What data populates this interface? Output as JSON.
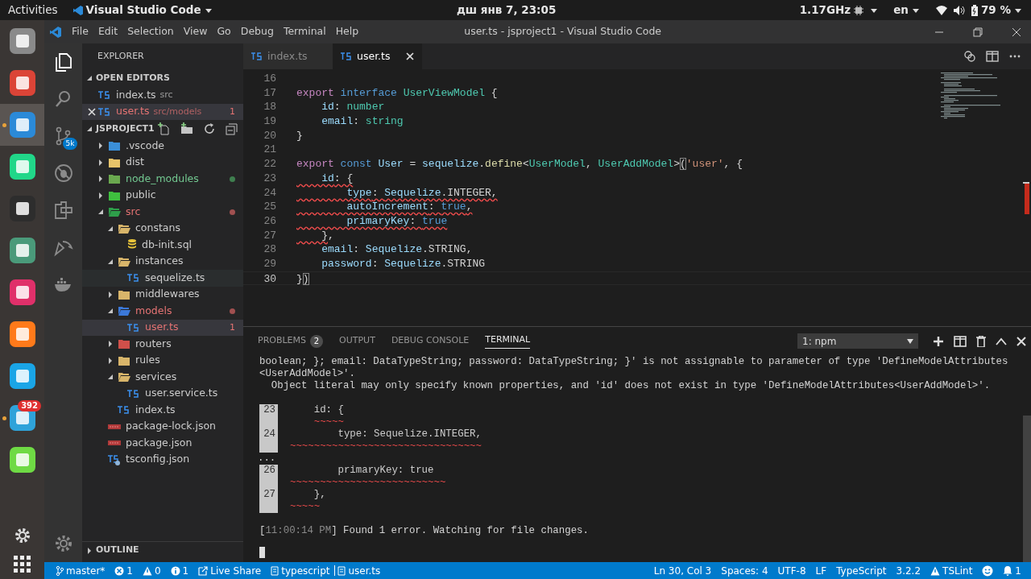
{
  "topbar": {
    "activities": "Activities",
    "app": "Visual Studio Code",
    "clock": "дш янв  7, 23:05",
    "cpu": "1.17GHz",
    "lang": "en",
    "battery": "79 %"
  },
  "dock": {
    "apps": [
      {
        "color": "#8a8a8a",
        "running": false,
        "selected": false
      },
      {
        "color": "#db4437",
        "running": false,
        "selected": false
      },
      {
        "color": "#2b8ad8",
        "running": true,
        "selected": true
      },
      {
        "color": "#21d789",
        "running": false,
        "selected": false
      },
      {
        "color": "#2d2d2d",
        "running": false,
        "selected": false
      },
      {
        "color": "#4a9a7a",
        "running": false,
        "selected": false
      },
      {
        "color": "#e0306a",
        "running": false,
        "selected": false
      },
      {
        "color": "#ff7a1a",
        "running": false,
        "selected": false
      },
      {
        "color": "#1aa5e6",
        "running": false,
        "selected": false
      },
      {
        "color": "#2fa3da",
        "running": true,
        "selected": false,
        "badge": "392"
      },
      {
        "color": "#6fda44",
        "running": false,
        "selected": false
      }
    ]
  },
  "window": {
    "title": "user.ts - jsproject1 - Visual Studio Code",
    "menu": [
      "File",
      "Edit",
      "Selection",
      "View",
      "Go",
      "Debug",
      "Terminal",
      "Help"
    ]
  },
  "activity_bar": [
    {
      "kind": "files",
      "selected": true
    },
    {
      "kind": "search",
      "selected": false
    },
    {
      "kind": "scm",
      "selected": false,
      "badge": "5k"
    },
    {
      "kind": "debug",
      "selected": false
    },
    {
      "kind": "extensions",
      "selected": false
    },
    {
      "kind": "share",
      "selected": false
    },
    {
      "kind": "docker",
      "selected": false
    }
  ],
  "sidebar": {
    "title": "EXPLORER",
    "open_editors": {
      "title": "OPEN EDITORS",
      "items": [
        {
          "label": "index.ts",
          "description": "src",
          "selected": false,
          "error": false
        },
        {
          "label": "user.ts",
          "description": "src/models",
          "selected": true,
          "error": true,
          "badge": "1"
        }
      ]
    },
    "project": {
      "title": "JSPROJECT1",
      "items": [
        {
          "label": ".vscode",
          "kind": "folder",
          "color": "#3b8fd8",
          "expanded": false
        },
        {
          "label": "dist",
          "kind": "folder",
          "color": "#e8c46a",
          "expanded": false
        },
        {
          "label": "node_modules",
          "kind": "folder",
          "color": "#6aa84f",
          "expanded": false,
          "untracked": true
        },
        {
          "label": "public",
          "kind": "folder",
          "color": "#3fbf3f",
          "expanded": false
        },
        {
          "label": "src",
          "kind": "folder",
          "color": "#2e9e4a",
          "expanded": true,
          "error": true,
          "children": [
            {
              "label": "constans",
              "kind": "folder",
              "color": "#d8b56a",
              "expanded": true,
              "children": [
                {
                  "label": "db-init.sql",
                  "kind": "sql"
                }
              ]
            },
            {
              "label": "instances",
              "kind": "folder",
              "color": "#d8b56a",
              "expanded": true,
              "children": [
                {
                  "label": "sequelize.ts",
                  "kind": "ts",
                  "hovered": true
                }
              ]
            },
            {
              "label": "middlewares",
              "kind": "folder",
              "color": "#d8b56a",
              "expanded": false
            },
            {
              "label": "models",
              "kind": "folder",
              "color": "#3b78d8",
              "expanded": true,
              "error": true,
              "children": [
                {
                  "label": "user.ts",
                  "kind": "ts",
                  "error": true,
                  "badge": "1",
                  "selected": true
                }
              ]
            },
            {
              "label": "routers",
              "kind": "folder",
              "color": "#d0504a",
              "expanded": false
            },
            {
              "label": "rules",
              "kind": "folder",
              "color": "#d8b56a",
              "expanded": false
            },
            {
              "label": "services",
              "kind": "folder",
              "color": "#d8b56a",
              "expanded": true,
              "children": [
                {
                  "label": "user.service.ts",
                  "kind": "ts"
                }
              ]
            },
            {
              "label": "index.ts",
              "kind": "ts"
            }
          ]
        },
        {
          "label": "package-lock.json",
          "kind": "json"
        },
        {
          "label": "package.json",
          "kind": "json"
        },
        {
          "label": "tsconfig.json",
          "kind": "tsconfig"
        }
      ]
    },
    "outline": {
      "title": "OUTLINE",
      "expanded": false
    }
  },
  "tabs": [
    {
      "label": "index.ts",
      "selected": false
    },
    {
      "label": "user.ts",
      "selected": true
    }
  ],
  "editor": {
    "lines": [
      {
        "number": "16",
        "current": false
      },
      {
        "number": "17",
        "current": false,
        "tokens": [
          {
            "text": "export",
            "kind": "kw"
          },
          {
            "text": " interface",
            "kind": "storage"
          },
          {
            "text": " UserViewModel",
            "kind": "type"
          },
          {
            "text": " {",
            "kind": "plain"
          }
        ]
      },
      {
        "number": "18",
        "current": false,
        "tokens": [
          {
            "text": "    id",
            "kind": "prop"
          },
          {
            "text": ": ",
            "kind": "plain"
          },
          {
            "text": "number",
            "kind": "type"
          }
        ]
      },
      {
        "number": "19",
        "current": false,
        "tokens": [
          {
            "text": "    email",
            "kind": "prop"
          },
          {
            "text": ": ",
            "kind": "plain"
          },
          {
            "text": "string",
            "kind": "type"
          }
        ]
      },
      {
        "number": "20",
        "current": false,
        "tokens": [
          {
            "text": "}",
            "kind": "plain"
          }
        ]
      },
      {
        "number": "21",
        "current": false
      },
      {
        "number": "22",
        "current": false,
        "tokens": [
          {
            "text": "export",
            "kind": "kw"
          },
          {
            "text": " const",
            "kind": "storage"
          },
          {
            "text": " User",
            "kind": "var"
          },
          {
            "text": " = ",
            "kind": "plain"
          },
          {
            "text": "sequelize",
            "kind": "var"
          },
          {
            "text": ".",
            "kind": "plain"
          },
          {
            "text": "define",
            "kind": "fn"
          },
          {
            "text": "<",
            "kind": "plain"
          },
          {
            "text": "UserModel",
            "kind": "type"
          },
          {
            "text": ", ",
            "kind": "plain"
          },
          {
            "text": "UserAddModel",
            "kind": "type"
          },
          {
            "text": ">",
            "kind": "plain"
          },
          {
            "text": "(",
            "kind": "bracket"
          },
          {
            "text": "'user'",
            "kind": "str"
          },
          {
            "text": ", {",
            "kind": "plain"
          }
        ]
      },
      {
        "number": "23",
        "current": false,
        "tokens": [
          {
            "text": "    id",
            "kind": "prop",
            "error": true
          },
          {
            "text": ": {",
            "kind": "plain",
            "error": true
          }
        ]
      },
      {
        "number": "24",
        "current": false,
        "tokens": [
          {
            "text": "        type",
            "kind": "prop",
            "error": true
          },
          {
            "text": ": ",
            "kind": "plain",
            "error": true
          },
          {
            "text": "Sequelize",
            "kind": "var",
            "error": true
          },
          {
            "text": ".INTEGER,",
            "kind": "plain",
            "error": true
          }
        ]
      },
      {
        "number": "25",
        "current": false,
        "tokens": [
          {
            "text": "        autoIncrement",
            "kind": "prop",
            "error": true
          },
          {
            "text": ": ",
            "kind": "plain",
            "error": true
          },
          {
            "text": "true",
            "kind": "storage",
            "error": true
          },
          {
            "text": ",",
            "kind": "plain",
            "error": true
          }
        ]
      },
      {
        "number": "26",
        "current": false,
        "tokens": [
          {
            "text": "        primaryKey",
            "kind": "prop",
            "error": true
          },
          {
            "text": ": ",
            "kind": "plain",
            "error": true
          },
          {
            "text": "true",
            "kind": "storage",
            "error": true
          }
        ]
      },
      {
        "number": "27",
        "current": false,
        "tokens": [
          {
            "text": "    }",
            "kind": "plain",
            "error": true
          },
          {
            "text": ",",
            "kind": "plain",
            "error": false
          }
        ]
      },
      {
        "number": "28",
        "current": false,
        "tokens": [
          {
            "text": "    email",
            "kind": "prop"
          },
          {
            "text": ": ",
            "kind": "plain"
          },
          {
            "text": "Sequelize",
            "kind": "var"
          },
          {
            "text": ".STRING,",
            "kind": "plain"
          }
        ]
      },
      {
        "number": "29",
        "current": false,
        "tokens": [
          {
            "text": "    password",
            "kind": "prop"
          },
          {
            "text": ": ",
            "kind": "plain"
          },
          {
            "text": "Sequelize",
            "kind": "var"
          },
          {
            "text": ".STRING",
            "kind": "plain"
          }
        ]
      },
      {
        "number": "30",
        "current": true,
        "tokens": [
          {
            "text": "}",
            "kind": "plain"
          },
          {
            "text": ")",
            "kind": "bracket"
          }
        ]
      }
    ]
  },
  "panel": {
    "tabs": [
      {
        "label": "PROBLEMS",
        "selected": false,
        "badge": "2"
      },
      {
        "label": "OUTPUT",
        "selected": false
      },
      {
        "label": "DEBUG CONSOLE",
        "selected": false
      },
      {
        "label": "TERMINAL",
        "selected": true
      }
    ],
    "terminal_select": "1: npm",
    "terminal": [
      {
        "kind": "message",
        "parts": [
          {
            "text": "boolean; }; email: DataTypeString; password: DataTypeString; }' is not assignable to parameter of type 'DefineModelAttributes",
            "kind": "plain"
          }
        ]
      },
      {
        "kind": "message",
        "parts": [
          {
            "text": "<UserAddModel>'.",
            "kind": "plain"
          }
        ]
      },
      {
        "kind": "message",
        "parts": [
          {
            "text": "  Object literal may only specify known properties, and 'id' does not exist in type 'DefineModelAttributes<UserAddModel>'.",
            "kind": "plain"
          }
        ]
      },
      {
        "kind": "blank"
      },
      {
        "kind": "code",
        "number": "23",
        "text": "    id: {"
      },
      {
        "kind": "marker",
        "text": "    ~~~~~"
      },
      {
        "kind": "code",
        "number": "24",
        "text": "        type: Sequelize.INTEGER,"
      },
      {
        "kind": "marker",
        "text": "~~~~~~~~~~~~~~~~~~~~~~~~~~~~~~~~"
      },
      {
        "kind": "ellipsis",
        "number": "..."
      },
      {
        "kind": "code",
        "number": "26",
        "text": "        primaryKey: true"
      },
      {
        "kind": "marker",
        "text": "~~~~~~~~~~~~~~~~~~~~~~~~~~"
      },
      {
        "kind": "code",
        "number": "27",
        "text": "    },"
      },
      {
        "kind": "marker",
        "text": "~~~~~"
      },
      {
        "kind": "blank"
      },
      {
        "kind": "message",
        "parts": [
          {
            "text": "[",
            "kind": "plain"
          },
          {
            "text": "11:00:14 PM",
            "kind": "time"
          },
          {
            "text": "] Found 1 error. Watching for file changes.",
            "kind": "plain"
          }
        ]
      },
      {
        "kind": "blank"
      },
      {
        "kind": "cursor"
      }
    ]
  },
  "status_bar": {
    "left": [
      {
        "kind": "branch",
        "text": "master*"
      },
      {
        "kind": "errors",
        "text": "1"
      },
      {
        "kind": "warnings",
        "text": "0"
      },
      {
        "kind": "info",
        "text": "1"
      },
      {
        "kind": "share",
        "text": "Live Share"
      },
      {
        "kind": "lang-ts",
        "text": "typescript"
      },
      {
        "kind": "file",
        "text": "user.ts"
      }
    ],
    "right": [
      {
        "kind": "text",
        "text": "Ln 30, Col 3"
      },
      {
        "kind": "text",
        "text": "Spaces: 4"
      },
      {
        "kind": "text",
        "text": "UTF-8"
      },
      {
        "kind": "text",
        "text": "LF"
      },
      {
        "kind": "text",
        "text": "TypeScript"
      },
      {
        "kind": "text",
        "text": "3.2.2"
      },
      {
        "kind": "lint",
        "text": "TSLint"
      },
      {
        "kind": "smiley"
      },
      {
        "kind": "bell",
        "text": "1"
      }
    ]
  }
}
